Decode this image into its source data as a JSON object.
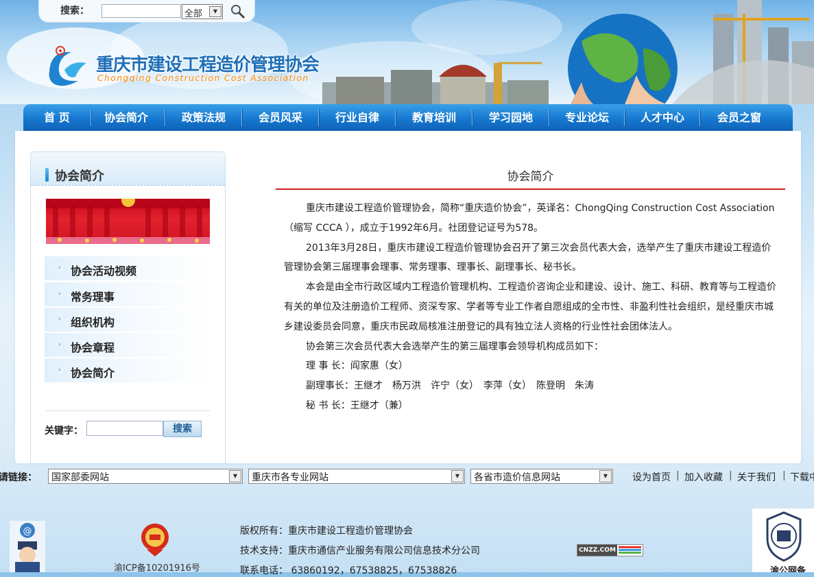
{
  "header": {
    "search_label": "搜索：",
    "search_scope": "全部",
    "site_title": "重庆市建设工程造价管理协会",
    "site_subtitle": "Chongqing Construction Cost Association"
  },
  "nav": {
    "items": [
      "首 页",
      "协会简介",
      "政策法规",
      "会员风采",
      "行业自律",
      "教育培训",
      "学习园地",
      "专业论坛",
      "人才中心",
      "会员之窗"
    ]
  },
  "sidebar": {
    "title": "协会简介",
    "items": [
      "协会活动视频",
      "常务理事",
      "组织机构",
      "协会章程",
      "协会简介"
    ],
    "keyword_label": "关键字：",
    "search_button": "搜索"
  },
  "article": {
    "title": "协会简介",
    "paragraphs": [
      "重庆市建设工程造价管理协会，简称“重庆造价协会”，英译名：ChongQing Construction Cost Association （缩写 CCCA ），成立于1992年6月。社团登记证号为578。",
      "2013年3月28日，重庆市建设工程造价管理协会召开了第三次会员代表大会，选举产生了重庆市建设工程造价管理协会第三届理事会理事、常务理事、理事长、副理事长、秘书长。",
      "本会是由全市行政区域内工程造价管理机构、工程造价咨询企业和建设、设计、施工、科研、教育等与工程造价有关的单位及注册造价工程师、资深专家、学者等专业工作者自愿组成的全市性、非盈利性社会组织，是经重庆市城乡建设委员会同意，重庆市民政局核准注册登记的具有独立法人资格的行业性社会团体法人。",
      "协会第三次会员代表大会选举产生的第三届理事会领导机构成员如下："
    ],
    "members": [
      "理 事 长：阎家惠（女）",
      "副理事长：王继才　杨万洪　许宁（女）　李萍（女）　陈登明　朱涛",
      "秘 书 长：王继才（兼）"
    ]
  },
  "links_bar": {
    "label": "请链接：",
    "selects": [
      "国家部委网站",
      "重庆市各专业网站",
      "各省市造价信息网站"
    ],
    "links": [
      "设为首页",
      "加入收藏",
      "关于我们",
      "下载中"
    ]
  },
  "footer": {
    "icp": "渝ICP备10201916号",
    "copyright": "版权所有：重庆市建设工程造价管理协会",
    "tech_support": "技术支持：重庆市通信产业服务有限公司信息技术分公司",
    "contact": "联系电话：  63860192，67538825，67538826",
    "badge_right": "渝公网备",
    "cnzz": "CNZZ.COM"
  },
  "colors": {
    "nav_blue": "#1678cf",
    "title_blue": "#1e6fb8",
    "rule_red": "#d61f1f",
    "subtitle_orange": "#ff8a00"
  }
}
